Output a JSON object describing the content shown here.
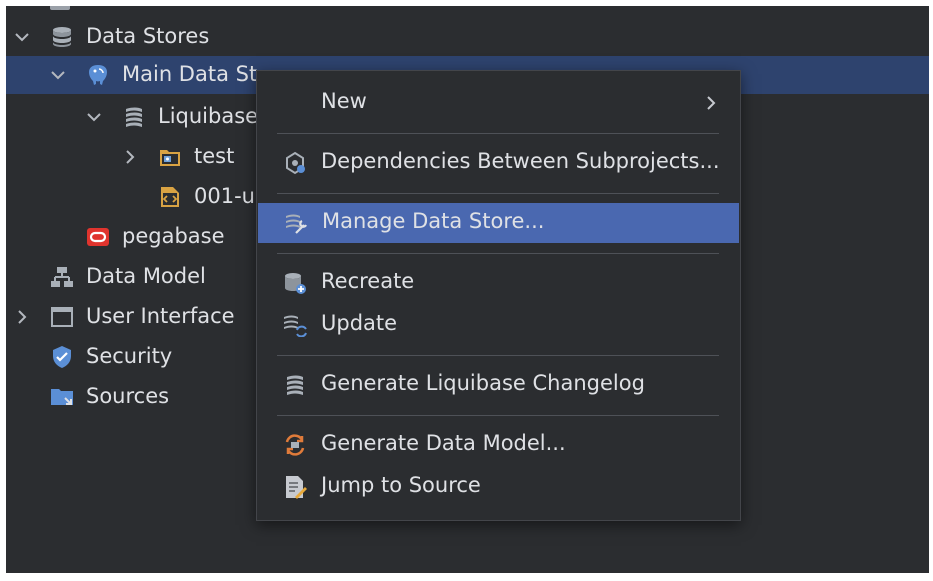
{
  "tree": {
    "items": [
      {
        "label": "Data Stores",
        "icon": "database-icon"
      },
      {
        "label": "Main Data St",
        "icon": "postgresql-icon"
      },
      {
        "label": "Liquibase",
        "icon": "liquibase-icon"
      },
      {
        "label": "test",
        "icon": "folder-icon"
      },
      {
        "label": "001-u",
        "icon": "changelog-file-icon"
      },
      {
        "label": "pegabase",
        "icon": "oracle-icon"
      },
      {
        "label": "Data Model",
        "icon": "data-model-icon"
      },
      {
        "label": "User Interface",
        "icon": "window-icon"
      },
      {
        "label": "Security",
        "icon": "shield-icon"
      },
      {
        "label": "Sources",
        "icon": "sources-folder-icon"
      }
    ]
  },
  "context_menu": {
    "items": [
      {
        "label": "New",
        "icon": "",
        "has_submenu": true
      },
      {
        "label": "Dependencies Between Subprojects...",
        "icon": "dependencies-icon"
      },
      {
        "label": "Manage Data Store...",
        "icon": "manage-datastore-icon",
        "highlighted": true
      },
      {
        "label": "Recreate",
        "icon": "recreate-icon"
      },
      {
        "label": "Update",
        "icon": "update-icon"
      },
      {
        "label": "Generate Liquibase Changelog",
        "icon": "liquibase-icon"
      },
      {
        "label": "Generate Data Model...",
        "icon": "generate-model-icon"
      },
      {
        "label": "Jump to Source",
        "icon": "jump-to-source-icon"
      }
    ]
  },
  "colors": {
    "background": "#2b2d30",
    "selection": "#2e436e",
    "menu_highlight": "#4a68b0",
    "text": "#dfe1e5"
  }
}
